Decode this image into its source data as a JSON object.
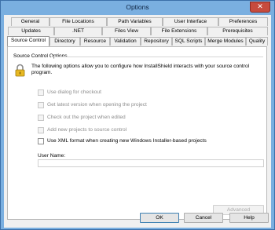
{
  "window": {
    "title": "Options",
    "close_glyph": "✕"
  },
  "tabs": {
    "row1": [
      "General",
      "File Locations",
      "Path Variables",
      "User Interface",
      "Preferences"
    ],
    "row2": [
      "Updates",
      ".NET",
      "Files View",
      "File Extensions",
      "Prerequisites"
    ],
    "row3": [
      "Source Control",
      "Directory",
      "Resource",
      "Validation",
      "Repository",
      "SQL Scripts",
      "Merge Modules",
      "Quality"
    ],
    "active": "Source Control"
  },
  "source_control": {
    "group_title": "Source Control Options",
    "intro": "The following options allow you to configure how InstallShield interacts with your source control program.",
    "options": [
      {
        "label": "Use dialog for checkout",
        "checked": false,
        "enabled": false
      },
      {
        "label": "Get latest version when opening the project",
        "checked": false,
        "enabled": false
      },
      {
        "label": "Check out the project when edited",
        "checked": false,
        "enabled": false
      },
      {
        "label": "Add new projects to source control",
        "checked": false,
        "enabled": false
      },
      {
        "label": "Use XML format when creating new Windows Installer-based projects",
        "checked": false,
        "enabled": true
      }
    ],
    "user_name_label": "User Name:",
    "user_name_value": "",
    "advanced_label": "Advanced"
  },
  "footer": {
    "ok": "OK",
    "cancel": "Cancel",
    "help": "Help"
  }
}
